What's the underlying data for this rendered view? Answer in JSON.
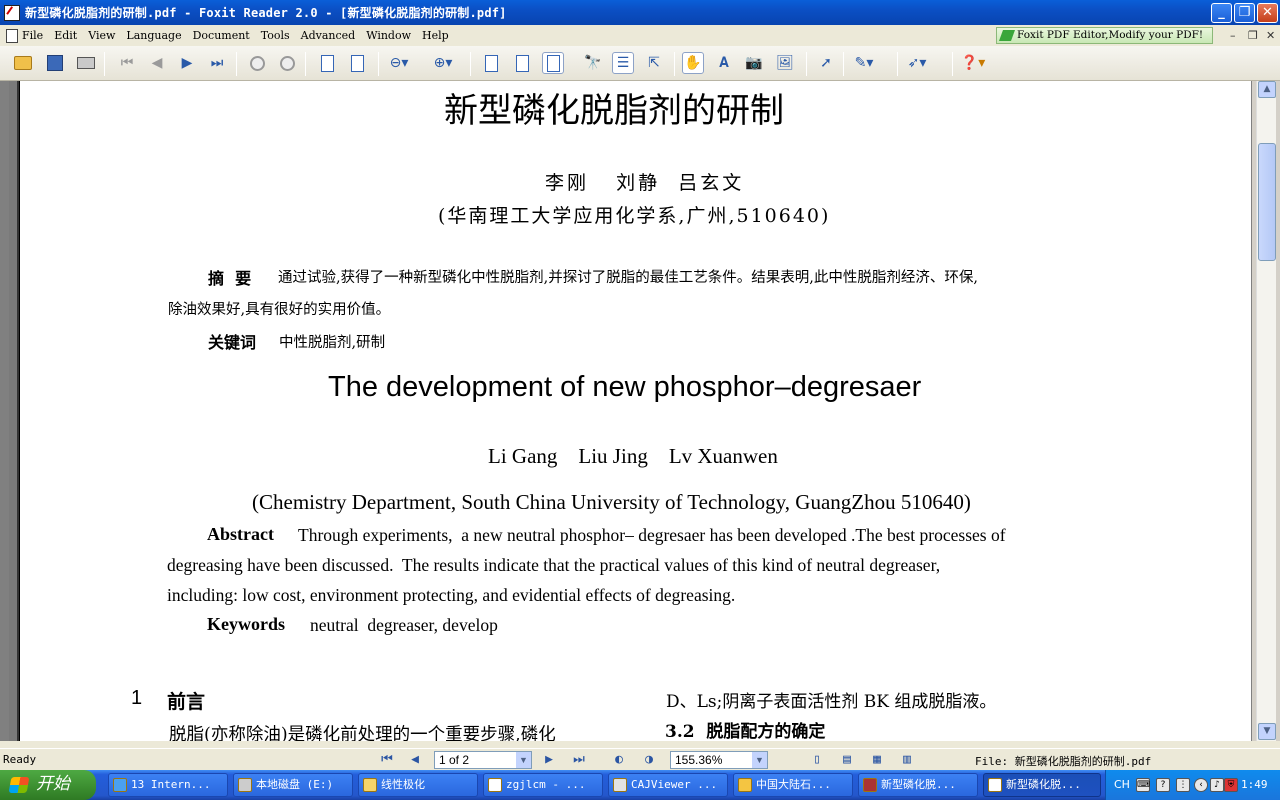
{
  "window": {
    "title": "新型磷化脱脂剂的研制.pdf - Foxit Reader 2.0 - [新型磷化脱脂剂的研制.pdf]"
  },
  "menu": {
    "items": [
      "File",
      "Edit",
      "View",
      "Language",
      "Document",
      "Tools",
      "Advanced",
      "Window",
      "Help"
    ],
    "promo": "Foxit PDF Editor,Modify your PDF!"
  },
  "toolbar": {
    "icons": [
      "open-icon",
      "save-icon",
      "print-icon",
      "first-page-icon",
      "prev-page-icon",
      "next-page-icon",
      "last-page-icon",
      "back-icon",
      "forward-icon",
      "extract-icon",
      "rotate-icon",
      "zoom-out-icon",
      "zoom-in-icon",
      "single-page-icon",
      "continuous-icon",
      "facing-icon",
      "find-icon",
      "bookmarks-icon",
      "fit-icon",
      "hand-tool-icon",
      "text-select-icon",
      "snapshot-icon",
      "image-icon",
      "select-arrow-icon",
      "annotation-icon",
      "typewriter-icon",
      "help-icon"
    ]
  },
  "document": {
    "title_zh": "新型磷化脱脂剂的研制",
    "authors_zh": "李刚   刘静  吕玄文",
    "affiliation_zh": "(华南理工大学应用化学系,广州,510640)",
    "abstract_label_zh": "摘  要",
    "abstract_zh_line1": "通过试验,获得了一种新型磷化中性脱脂剂,并探讨了脱脂的最佳工艺条件。结果表明,此中性脱脂剂经济、环保,",
    "abstract_zh_line2": "除油效果好,具有很好的实用价值。",
    "keywords_label_zh": "关键词",
    "keywords_zh": "中性脱脂剂,研制",
    "title_en": "The development of new phosphor–degresaer",
    "authors_en": "Li Gang    Liu Jing    Lv Xuanwen",
    "affiliation_en": "(Chemistry Department, South China University of Technology, GuangZhou 510640)",
    "abstract_label_en": "Abstract",
    "abstract_en_line1": "Through experiments,  a new neutral phosphor– degresaer has been developed .The best processes of",
    "abstract_en_line2": "degreasing have been discussed.  The results indicate that the practical values of this kind of neutral degreaser,",
    "abstract_en_line3": "including: low cost, environment protecting, and evidential effects of degreasing.",
    "keywords_label_en": "Keywords",
    "keywords_en": "neutral  degreaser, develop",
    "section1_num": "1",
    "section1_title": "前言",
    "section1_text": "脱脂(亦称除油)是磷化前处理的一个重要步骤,磷化",
    "right_col_line1": "D、Ls;阴离子表面活性剂 BK 组成脱脂液。",
    "section32_title": "3.2  脱脂配方的确定"
  },
  "statusbar": {
    "ready": "Ready",
    "page_indicator": "1 of 2",
    "zoom": "155.36%",
    "file_label": "File: 新型磷化脱脂剂的研制.pdf"
  },
  "taskbar": {
    "start_label": "开始",
    "tasks": [
      "13 Intern...",
      "本地磁盘 (E:)",
      "线性极化",
      "zgjlcm - ...",
      "CAJViewer ...",
      "中国大陆石...",
      "新型磷化脱...",
      "新型磷化脱..."
    ],
    "tray_lang": "CH",
    "clock": "1:49"
  }
}
